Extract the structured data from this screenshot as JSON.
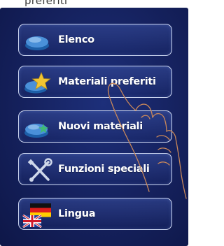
{
  "top_caption": "preferiti",
  "menu": {
    "items": [
      {
        "label": "Elenco",
        "icon": "list-pill-icon"
      },
      {
        "label": "Materiali preferiti",
        "icon": "star-pill-icon"
      },
      {
        "label": "Nuovi materiali",
        "icon": "new-material-pill-icon"
      },
      {
        "label": "Funzioni speciali",
        "icon": "tools-icon"
      },
      {
        "label": "Lingua",
        "icon": "language-flags-icon"
      }
    ]
  },
  "colors": {
    "screen_background": "#15215d",
    "button_border": "#c9d3ee",
    "label_text": "#ffffff",
    "pill_icon": "#4a90d9",
    "star_icon": "#f2c531"
  }
}
